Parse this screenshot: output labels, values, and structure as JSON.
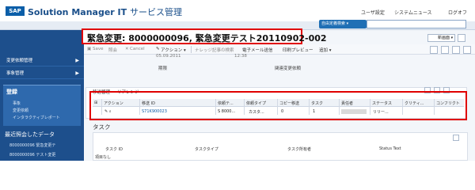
{
  "header": {
    "logo": "SAP",
    "app_title": "Solution Manager IT",
    "app_subtitle": "サービス管理",
    "links": [
      "ユーザ設定",
      "システムニュース",
      "ログオフ"
    ]
  },
  "search": {
    "select_label": "自由定義検索 ▾",
    "input_value": ""
  },
  "leftnav": {
    "items": [
      {
        "label": "変更依頼管理",
        "chev": "▶"
      },
      {
        "label": "事象管理",
        "chev": "▶"
      }
    ],
    "section": {
      "title": "登録",
      "items": [
        "事象",
        "変更依頼",
        "インタラクティブレポート"
      ]
    },
    "recent": {
      "title": "最近照会したデータ",
      "items": [
        "8000000096 緊急変更テ",
        "8000000096 テスト変更"
      ]
    }
  },
  "page": {
    "title": "緊急変更: 8000000096, 緊急変更テスト20110902-002",
    "view_select": "新画面",
    "dropdown_chev": "▾"
  },
  "toolbar": {
    "items": [
      "Save",
      "照会",
      "Cancel",
      "アクション ▾",
      "ナレッジ記事の検索",
      "電子メール送信",
      "印刷プレビュー",
      "追加 ▾"
    ],
    "save_icon": "▣",
    "cancel_icon": "✕",
    "edit_icon": "✎"
  },
  "details": {
    "lines": [
      {
        "label": "期限",
        "value": ""
      },
      {
        "label": "関連変更依頼",
        "value": ""
      }
    ],
    "date_partial": "05.09.2011",
    "time_partial": "12:38"
  },
  "assignment": {
    "section_title": "移送管理",
    "tab_label": "リアレンジ",
    "table": {
      "columns": [
        "アクション",
        "移送 ID",
        "依頼テ...",
        "依頼タイプ",
        "コピー移送",
        "タスク",
        "責任者",
        "ステータス",
        "クリティ...",
        "コンフリクト"
      ],
      "rows": [
        {
          "action": "✎ ⌕",
          "transport_id": "S71K900023",
          "desc": "S 8000...",
          "type": "カスタ...",
          "copy": "0",
          "task": "1",
          "owner": "",
          "status": "リリー...",
          "critical": "",
          "conflict": ""
        }
      ]
    }
  },
  "tasks": {
    "title": "タスク",
    "columns": [
      "タスク ID",
      "タスクタイプ",
      "タスク所有者",
      "Status Text"
    ],
    "empty": "項目なし"
  },
  "colors": {
    "nav_bg": "#1d4f8c",
    "highlight": "#e00000",
    "link": "#0c5aa6"
  }
}
